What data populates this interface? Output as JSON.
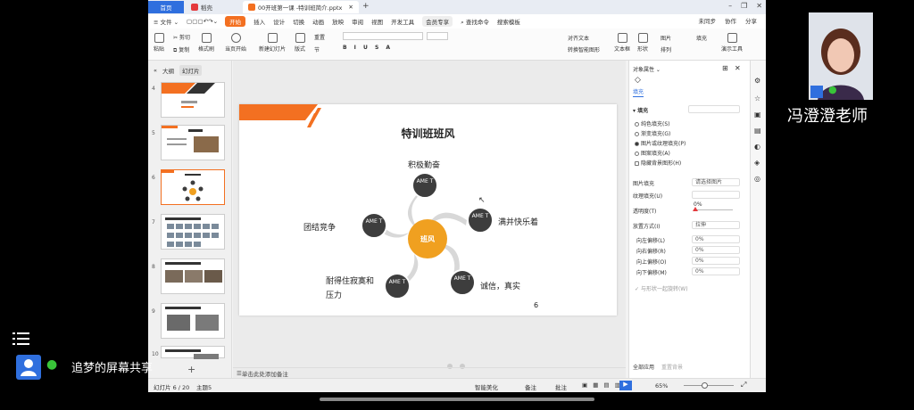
{
  "titlebar": {
    "home_tab": "首页",
    "docer_tab": "稻壳",
    "file_tab": "00开班第一课 -特训班简介.pptx",
    "add_tab": "+"
  },
  "menubar": {
    "items": [
      "≡ 文件 ⌄",
      "开始",
      "插入",
      "设计",
      "切换",
      "动画",
      "放映",
      "审阅",
      "视图",
      "开发工具",
      "会员专享",
      "查找命令",
      "搜索模板"
    ],
    "active": "开始",
    "right": [
      "未同步",
      "协作",
      "分享"
    ]
  },
  "ribbon": {
    "items": [
      "粘贴",
      "剪切",
      "复制",
      "格式刷",
      "当页开始",
      "新建幻灯片",
      "版式",
      "节",
      "重置",
      "文本框",
      "形状",
      "排列",
      "演示工具"
    ],
    "labels_extra": [
      "对齐文本",
      "转换智能图形",
      "图片",
      "填充"
    ]
  },
  "leftpanel": {
    "tabs": [
      "大纲",
      "幻灯片"
    ],
    "thumbs": [
      "4",
      "5",
      "6",
      "7",
      "8",
      "9",
      "10"
    ],
    "selected": "6"
  },
  "slide": {
    "title": "特训班班风",
    "center": "班风",
    "node_text": "AME T",
    "labels": [
      "积极勤奋",
      "满并快乐着",
      "诚信，真实",
      "耐得住寂寞和",
      "压力",
      "团结竞争"
    ],
    "page_number": "6"
  },
  "notes_placeholder": "单击此处添加备注",
  "rightpanel": {
    "header": "对象属性 ⌄",
    "tab": "填充",
    "section": "▾ 填充",
    "options": [
      "纯色填充(S)",
      "渐变填充(G)",
      "图片或纹理填充(P)",
      "图案填充(A)",
      "隐藏背景图形(H)"
    ],
    "picture_fill_label": "图片填充",
    "picture_fill_value": "请选择图片",
    "texture_fill_label": "纹理填充(U)",
    "transparency_label": "透明度(T)",
    "transparency_value": "0%",
    "placement_label": "放置方式(I)",
    "placement_value": "拉伸",
    "offsets": [
      {
        "label": "向左偏移(L)",
        "value": "0%"
      },
      {
        "label": "向右偏移(R)",
        "value": "0%"
      },
      {
        "label": "向上偏移(O)",
        "value": "0%"
      },
      {
        "label": "向下偏移(M)",
        "value": "0%"
      }
    ],
    "rotate_label": "与形状一起旋转(W)",
    "footer": [
      "全部应用",
      "重置背景"
    ]
  },
  "statusbar": {
    "slide_info": "幻灯片 6 / 20",
    "theme": "主题5",
    "beautify": "智能美化",
    "notes": "备注",
    "comments": "批注",
    "zoom": "65%"
  },
  "overlay": {
    "teacher_name": "冯澄澄老师",
    "share_label": "追梦的屏幕共享"
  },
  "colors": {
    "accent_orange": "#f37021",
    "center_circle": "#f0a020",
    "node_dark": "#3d3d3d",
    "wps_blue": "#2f6fde"
  }
}
